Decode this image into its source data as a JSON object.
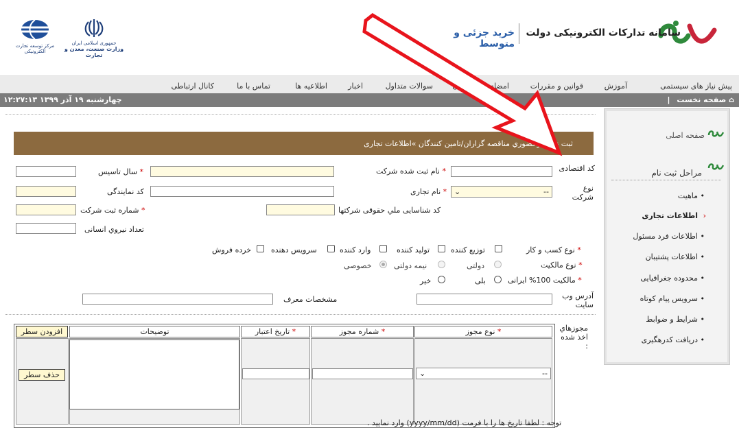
{
  "header": {
    "system_title": "سامانه تدارکات الکترونیکی دولت",
    "sub_title": "خرید جزئی و متوسط",
    "ministry_line1": "جمهوری اسلامی ایران",
    "ministry_line2": "وزارت صنعت، معدن و تجارت",
    "center_name": "مرکز توسعه تجارت الکترونیکی"
  },
  "nav": {
    "items": [
      "پیش نیاز های سیستمی",
      "آموزش",
      "قوانین و مقررات",
      "امضای الکترونیکی",
      "سوالات متداول",
      "اخبار",
      "اطلاعیه ها",
      "تماس با ما",
      "کانال ارتباطی"
    ]
  },
  "status": {
    "home": "صفحه نخست",
    "datetime": "چهارشنبه ۱۹ آذر ۱۳۹۹   ۱۲:۲۷:۱۳"
  },
  "sidebar": {
    "home_link": "صفحه اصلی",
    "steps_title": "مراحل ثبت نام",
    "items": [
      "ماهیت",
      "اطلاعات تجاری",
      "اطلاعات فرد مسئول",
      "اطلاعات پشتیبان",
      "محدوده جغرافیایی",
      "سرویس پیام کوتاه",
      "شرایط و ضوابط",
      "دریافت کدرهگیری"
    ]
  },
  "banner": {
    "text": "ثبت نام غیرحضوري مناقصه گزاران/تامین کنندگان »اطلاعات تجاری"
  },
  "form": {
    "economic_code": "کد اقتصادی",
    "registered_name": "نام ثبت شده شرکت",
    "founding_year": "سال تاسیس",
    "company_type": "نوع شرکت",
    "company_type_value": "--",
    "trade_name": "نام تجاری",
    "agency_code": "کد نمایندگی",
    "national_id": "کد شناسایی ملي حقوقی شرکتها",
    "reg_number": "شماره ثبت شرکت",
    "workforce": "تعداد نیروي انسانی",
    "business_type": "نوع کسب و کار",
    "business_options": [
      "توزیع کننده",
      "تولید کننده",
      "وارد کننده",
      "سرویس دهنده",
      "خرده فروش"
    ],
    "ownership_type": "نوع مالکیت",
    "ownership_options": [
      "دولتی",
      "نیمه دولتی",
      "خصوصی"
    ],
    "iranian_ownership": "مالکیت 100% ایرانی",
    "yes": "بلی",
    "no": "خیر",
    "website": "آدرس وب سایت",
    "referrer": "مشخصات معرف",
    "licenses": "مجوزهاي اخذ شده :",
    "note": "توجه : لطفا تاریخ ها را با فرمت (yyyy/mm/dd) وارد نمایید ."
  },
  "grid": {
    "columns": [
      "نوع مجوز",
      "شماره مجوز",
      "تاریخ اعتبار",
      "توضیحات"
    ],
    "add_row": "افزودن سطر",
    "delete_row": "حذف سطر",
    "license_type_value": "--"
  },
  "colors": {
    "banner": "#8c6a3f",
    "status_bar": "#7c7c7c",
    "required": "#cc0000",
    "sub_title": "#2a5ea8",
    "arrow": "#e8141c"
  }
}
